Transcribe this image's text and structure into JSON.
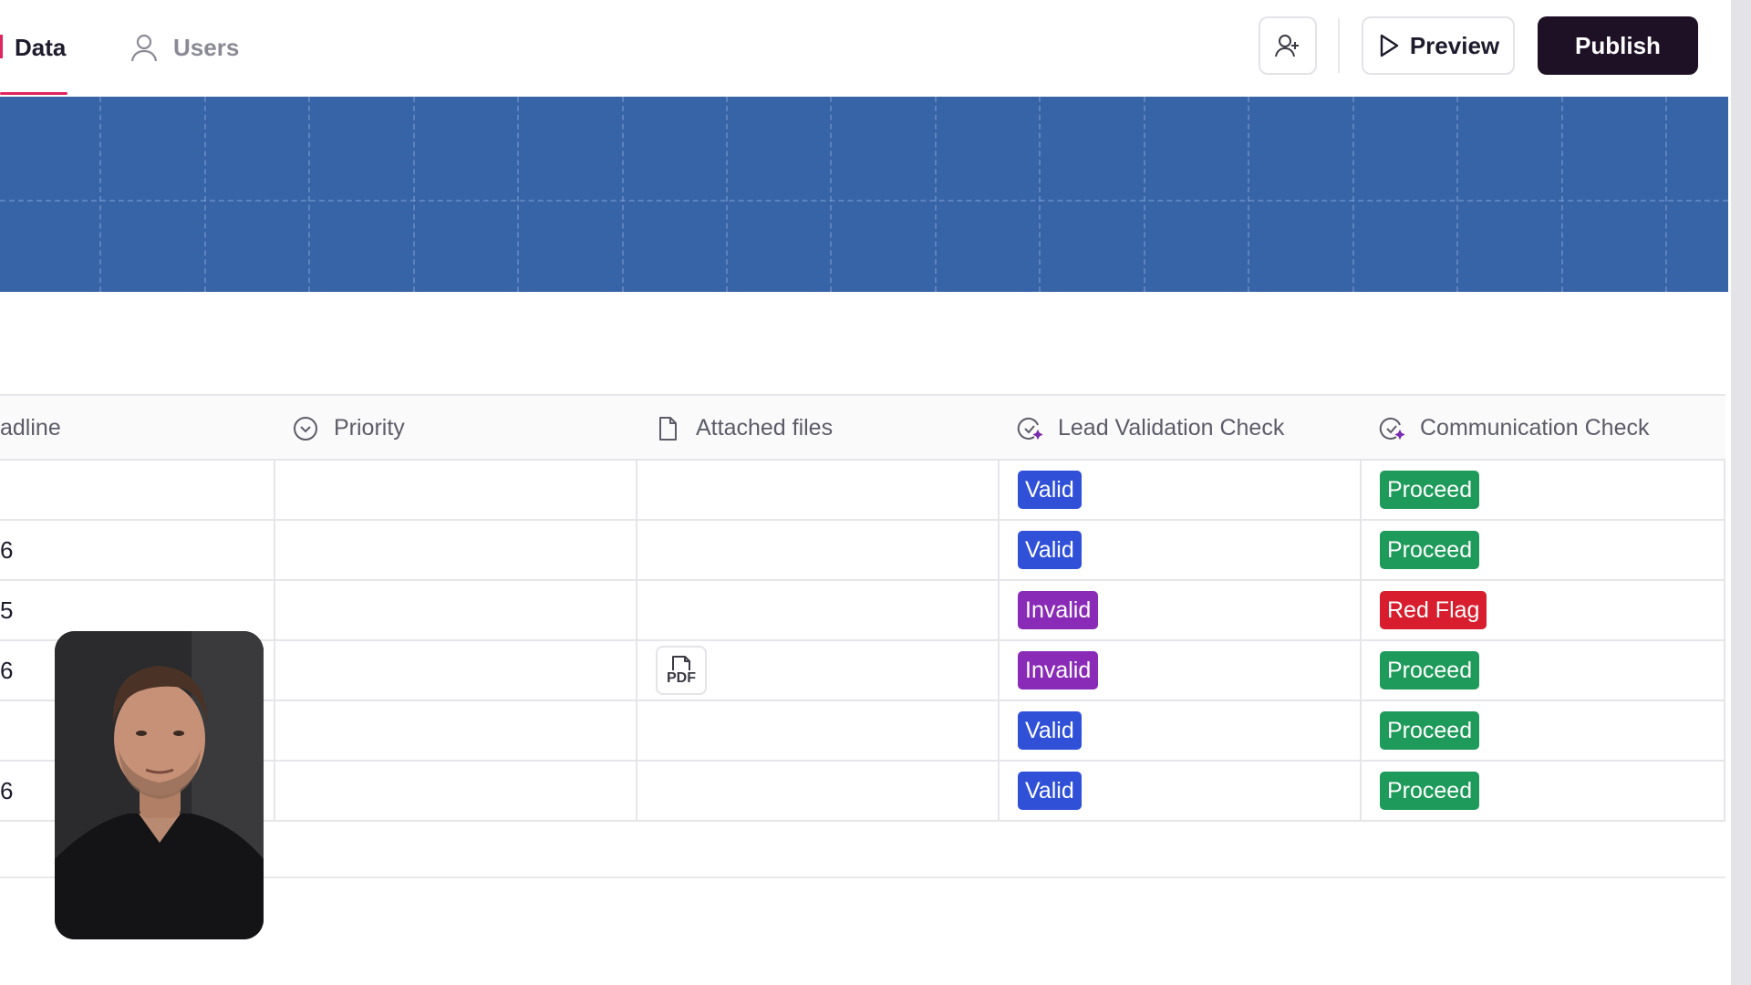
{
  "tabs": [
    {
      "label": "Data",
      "active": true
    },
    {
      "label": "Users",
      "active": false
    }
  ],
  "toolbar": {
    "invite_icon": "user-plus-icon",
    "preview_label": "Preview",
    "publish_label": "Publish"
  },
  "colors": {
    "accent": "#e0245e",
    "banner": "#3763a7",
    "publish": "#1e1125",
    "valid": "#3050d8",
    "invalid": "#8a2bb8",
    "proceed": "#1e9a5a",
    "red_flag": "#d71d2e"
  },
  "table": {
    "columns": [
      {
        "label": "adline",
        "icon": ""
      },
      {
        "label": "Priority",
        "icon": "circle-chevron-icon"
      },
      {
        "label": "Attached files",
        "icon": "file-icon"
      },
      {
        "label": "Lead Validation Check",
        "icon": "ai-check-icon"
      },
      {
        "label": "Communication Check",
        "icon": "ai-check-icon"
      }
    ],
    "rows": [
      {
        "deadline": "",
        "priority": "",
        "file": "",
        "lead": "Valid",
        "comm": "Proceed"
      },
      {
        "deadline": "6",
        "priority": "",
        "file": "",
        "lead": "Valid",
        "comm": "Proceed"
      },
      {
        "deadline": "5",
        "priority": "",
        "file": "",
        "lead": "Invalid",
        "comm": "Red Flag"
      },
      {
        "deadline": "6",
        "priority": "",
        "file": "PDF",
        "lead": "Invalid",
        "comm": "Proceed"
      },
      {
        "deadline": "",
        "priority": "",
        "file": "",
        "lead": "Valid",
        "comm": "Proceed"
      },
      {
        "deadline": "6",
        "priority": "",
        "file": "",
        "lead": "Valid",
        "comm": "Proceed"
      }
    ]
  }
}
